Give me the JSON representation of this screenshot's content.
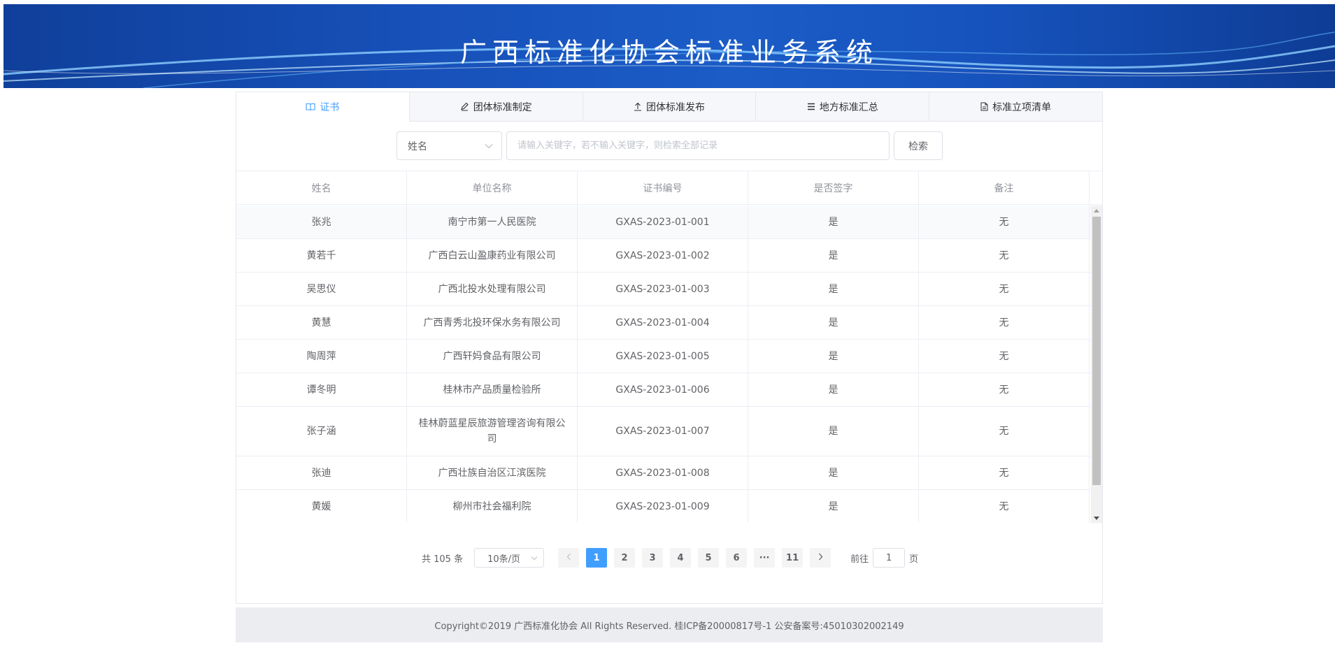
{
  "banner": {
    "title": "广西标准化协会标准业务系统"
  },
  "tabs": [
    {
      "label": "证书",
      "icon": "book-icon",
      "active": true
    },
    {
      "label": "团体标准制定",
      "icon": "edit-icon",
      "active": false
    },
    {
      "label": "团体标准发布",
      "icon": "upload-icon",
      "active": false
    },
    {
      "label": "地方标准汇总",
      "icon": "list-icon",
      "active": false
    },
    {
      "label": "标准立项清单",
      "icon": "document-icon",
      "active": false
    }
  ],
  "search": {
    "field_value": "姓名",
    "placeholder": "请输入关键字，若不输入关键字，则检索全部记录",
    "button_label": "检索"
  },
  "table": {
    "columns": [
      "姓名",
      "单位名称",
      "证书编号",
      "是否签字",
      "备注"
    ],
    "rows": [
      [
        "张兆",
        "南宁市第一人民医院",
        "GXAS-2023-01-001",
        "是",
        "无"
      ],
      [
        "黄若千",
        "广西白云山盈康药业有限公司",
        "GXAS-2023-01-002",
        "是",
        "无"
      ],
      [
        "吴思仪",
        "广西北投水处理有限公司",
        "GXAS-2023-01-003",
        "是",
        "无"
      ],
      [
        "黄慧",
        "广西青秀北投环保水务有限公司",
        "GXAS-2023-01-004",
        "是",
        "无"
      ],
      [
        "陶周萍",
        "广西轩妈食品有限公司",
        "GXAS-2023-01-005",
        "是",
        "无"
      ],
      [
        "谭冬明",
        "桂林市产品质量检验所",
        "GXAS-2023-01-006",
        "是",
        "无"
      ],
      [
        "张子涵",
        "桂林蔚蓝星辰旅游管理咨询有限公司",
        "GXAS-2023-01-007",
        "是",
        "无"
      ],
      [
        "张迪",
        "广西壮族自治区江滨医院",
        "GXAS-2023-01-008",
        "是",
        "无"
      ],
      [
        "黄媛",
        "柳州市社会福利院",
        "GXAS-2023-01-009",
        "是",
        "无"
      ]
    ]
  },
  "pagination": {
    "total_text": "共 105 条",
    "page_size": "10条/页",
    "pages": [
      "1",
      "2",
      "3",
      "4",
      "5",
      "6",
      "···",
      "11"
    ],
    "current": "1",
    "goto_prefix": "前往",
    "goto_value": "1",
    "goto_suffix": "页"
  },
  "footer": {
    "text": "Copyright©2019 广西标准化协会 All Rights Reserved. 桂ICP备20000817号-1 公安备案号:45010302002149"
  },
  "colors": {
    "accent": "#409eff",
    "banner": "#1652bb",
    "footer_bg": "#ebedf0"
  }
}
